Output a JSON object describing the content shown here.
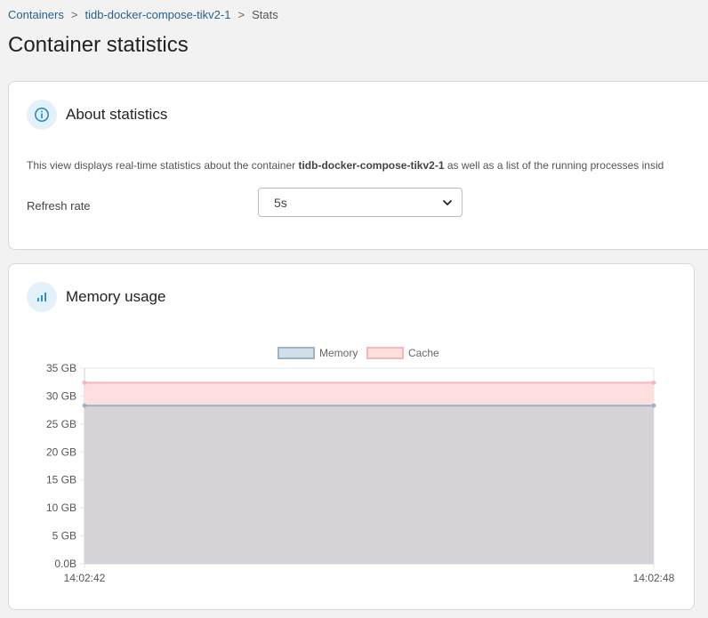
{
  "breadcrumb": {
    "items": [
      "Containers",
      "tidb-docker-compose-tikv2-1",
      "Stats"
    ],
    "separator": ">"
  },
  "page": {
    "title": "Container statistics"
  },
  "about": {
    "title": "About statistics",
    "icon": "info-icon",
    "text_before": "This view displays real-time statistics about the container ",
    "container_name": "tidb-docker-compose-tikv2-1",
    "text_after": " as well as a list of the running processes insid",
    "refresh_label": "Refresh rate",
    "refresh_value": "5s"
  },
  "memory": {
    "title": "Memory usage",
    "icon": "bar-chart-icon"
  },
  "colors": {
    "link": "#2b5f8a",
    "memory_fill": "#d6d3d8",
    "memory_line": "#9db4c8",
    "memory_legend": "#cfe0ea",
    "cache_fill": "#ffdede",
    "cache_line": "#f5b7b7",
    "accent_icon": "#1a86c7"
  },
  "chart_data": {
    "type": "area",
    "title": "",
    "xlabel": "",
    "ylabel": "",
    "x": [
      "14:02:42",
      "14:02:48"
    ],
    "series": [
      {
        "name": "Memory",
        "values": [
          28.3,
          28.3
        ]
      },
      {
        "name": "Cache",
        "values": [
          32.4,
          32.4
        ]
      }
    ],
    "y_ticks": [
      "35 GB",
      "30 GB",
      "25 GB",
      "20 GB",
      "15 GB",
      "10 GB",
      "5 GB",
      "0.0B"
    ],
    "ylim": [
      0,
      35
    ],
    "grid": true,
    "legend": "top-center"
  }
}
